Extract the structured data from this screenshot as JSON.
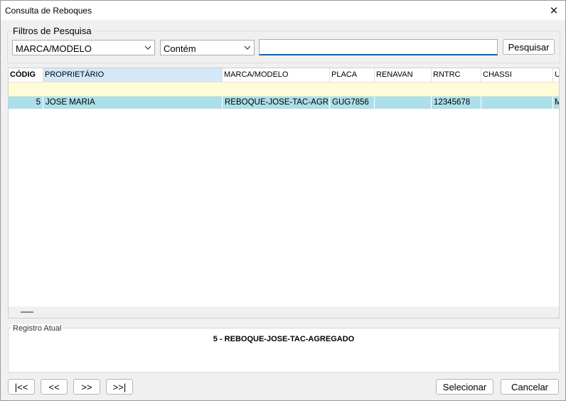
{
  "window": {
    "title": "Consulta de Reboques"
  },
  "filters": {
    "legend": "Filtros de Pesquisa",
    "field_select": "MARCA/MODELO",
    "operator_select": "Contém",
    "search_value": "",
    "search_button": "Pesquisar"
  },
  "grid": {
    "columns": [
      "CÓDIG",
      "PROPRIETÁRIO",
      "MARCA/MODELO",
      "PLACA",
      "RENAVAN",
      "RNTRC",
      "CHASSI",
      "U"
    ],
    "rows": [
      {
        "codigo": "5",
        "proprietario": "JOSE MARIA",
        "marca_modelo": "REBOQUE-JOSE-TAC-AGREGADO",
        "placa": "GUG7856",
        "renavan": "",
        "rntrc": "12345678",
        "chassi": "",
        "u": "M"
      }
    ]
  },
  "current_record": {
    "legend": "Registro Atual",
    "value": "5 - REBOQUE-JOSE-TAC-AGREGADO"
  },
  "nav": {
    "first": "|<<",
    "prev": "<<",
    "next": ">>",
    "last": ">>|"
  },
  "actions": {
    "select": "Selecionar",
    "cancel": "Cancelar"
  },
  "colors": {
    "selected_row": "#acdfea",
    "filter_row": "#fefcd8",
    "selected_header": "#d5e8f7",
    "accent": "#0067c0"
  }
}
